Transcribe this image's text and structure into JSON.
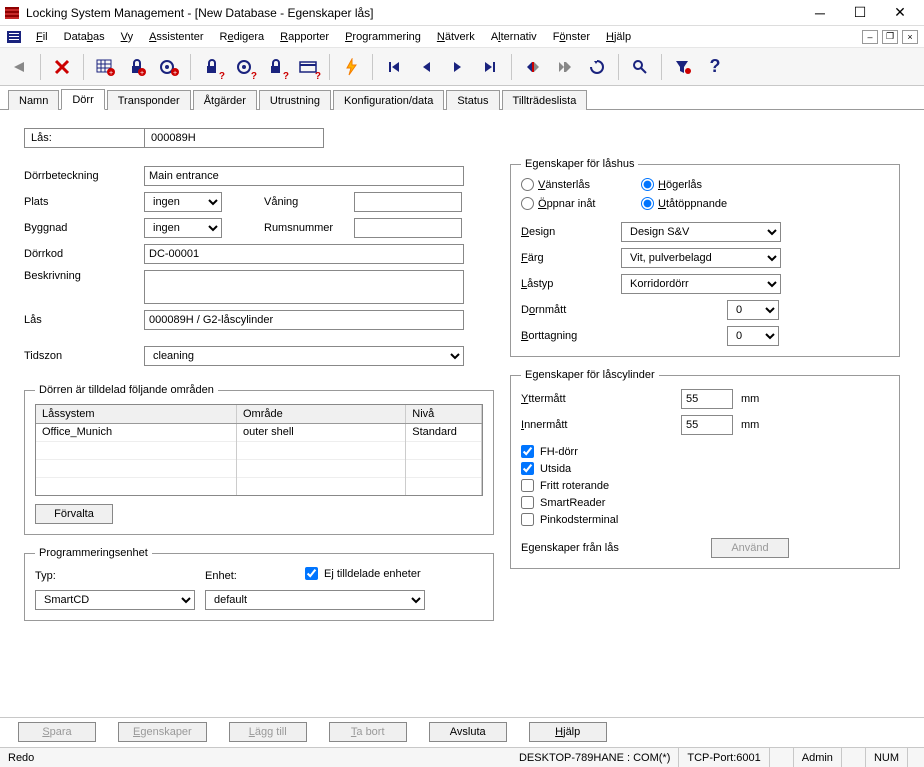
{
  "window": {
    "title": "Locking System Management - [New Database - Egenskaper lås]"
  },
  "menu": {
    "items": [
      "Fil",
      "Databas",
      "Vy",
      "Assistenter",
      "Redigera",
      "Rapporter",
      "Programmering",
      "Nätverk",
      "Alternativ",
      "Fönster",
      "Hjälp"
    ]
  },
  "tabs": [
    "Namn",
    "Dörr",
    "Transponder",
    "Åtgärder",
    "Utrustning",
    "Konfiguration/data",
    "Status",
    "Tillträdeslista"
  ],
  "active_tab": "Dörr",
  "lock": {
    "label": "Lås:",
    "value": "000089H"
  },
  "fields": {
    "dorrbeteckning_label": "Dörrbeteckning",
    "dorrbeteckning": "Main entrance",
    "plats_label": "Plats",
    "plats": "ingen",
    "vaning_label": "Våning",
    "vaning": "",
    "byggnad_label": "Byggnad",
    "byggnad": "ingen",
    "rumsnummer_label": "Rumsnummer",
    "rumsnummer": "",
    "dorrkod_label": "Dörrkod",
    "dorrkod": "DC-00001",
    "beskrivning_label": "Beskrivning",
    "beskrivning": "",
    "las_label": "Lås",
    "las": "000089H / G2-låscylinder",
    "tidszon_label": "Tidszon",
    "tidszon": "cleaning"
  },
  "areas": {
    "legend": "Dörren är tilldelad följande områden",
    "headers": [
      "Låssystem",
      "Område",
      "Nivå"
    ],
    "rows": [
      {
        "system": "Office_Munich",
        "area": "outer shell",
        "level": "Standard"
      }
    ],
    "manage_btn": "Förvalta"
  },
  "prog": {
    "legend": "Programmeringsenhet",
    "typ_label": "Typ:",
    "typ": "SmartCD",
    "enhet_label": "Enhet:",
    "enhet": "default",
    "unassigned_label": "Ej tilldelade enheter",
    "unassigned": true
  },
  "lashus": {
    "legend": "Egenskaper för låshus",
    "vansterlas": "Vänsterlås",
    "hogerlas": "Högerlås",
    "oppnar_inat": "Öppnar inåt",
    "utatoppnande": "Utåtöppnande",
    "side_selected": "hoger",
    "open_selected": "utat",
    "design_label": "Design",
    "design": "Design S&V",
    "farg_label": "Färg",
    "farg": "Vit, pulverbelagd",
    "lastyp_label": "Låstyp",
    "lastyp": "Korridordörr",
    "dormmatt_label": "Dornmått",
    "dormmatt": "0",
    "borttagning_label": "Borttagning",
    "borttagning": "0"
  },
  "cylinder": {
    "legend": "Egenskaper för låscylinder",
    "yttermatt_label": "Yttermått",
    "yttermatt": "55",
    "innermatt_label": "Innermått",
    "innermatt": "55",
    "unit": "mm",
    "fh_dorr": "FH-dörr",
    "utsida": "Utsida",
    "fritt": "Fritt roterande",
    "smartreader": "SmartReader",
    "pinkod": "Pinkodsterminal",
    "fh_dorr_checked": true,
    "utsida_checked": true,
    "fritt_checked": false,
    "smartreader_checked": false,
    "pinkod_checked": false,
    "from_lock_label": "Egenskaper från lås",
    "apply_btn": "Använd"
  },
  "footer": {
    "spara": "Spara",
    "egenskaper": "Egenskaper",
    "laggtill": "Lägg till",
    "tabort": "Ta bort",
    "avsluta": "Avsluta",
    "hjalp": "Hjälp"
  },
  "status": {
    "redo": "Redo",
    "desktop": "DESKTOP-789HANE : COM(*)",
    "tcp": "TCP-Port:6001",
    "admin": "Admin",
    "num": "NUM"
  }
}
